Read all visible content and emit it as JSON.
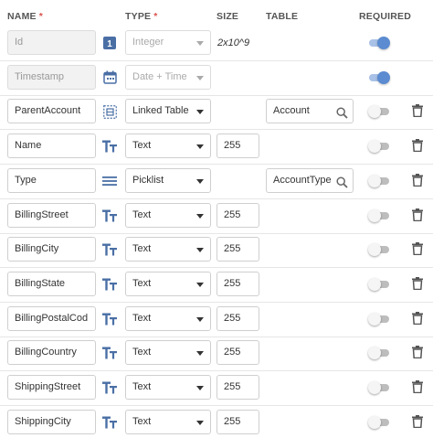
{
  "header": {
    "name": "NAME",
    "type": "TYPE",
    "size": "SIZE",
    "table": "TABLE",
    "required": "REQUIRED",
    "required_marker": "*"
  },
  "rows": [
    {
      "name": "Id",
      "type": "Integer",
      "size": "2x10^9",
      "table": "",
      "required": true,
      "locked": true,
      "icon": "number-badge-icon",
      "icon_text": "1"
    },
    {
      "name": "Timestamp",
      "type": "Date + Time",
      "size": "",
      "table": "",
      "required": true,
      "locked": true,
      "icon": "calendar-icon"
    },
    {
      "name": "ParentAccount",
      "type": "Linked Table",
      "size": "",
      "table": "Account",
      "required": false,
      "locked": false,
      "icon": "linked-table-icon"
    },
    {
      "name": "Name",
      "type": "Text",
      "size": "255",
      "table": "",
      "required": false,
      "locked": false,
      "icon": "text-type-icon"
    },
    {
      "name": "Type",
      "type": "Picklist",
      "size": "",
      "table": "AccountType",
      "required": false,
      "locked": false,
      "icon": "picklist-icon"
    },
    {
      "name": "BillingStreet",
      "type": "Text",
      "size": "255",
      "table": "",
      "required": false,
      "locked": false,
      "icon": "text-type-icon"
    },
    {
      "name": "BillingCity",
      "type": "Text",
      "size": "255",
      "table": "",
      "required": false,
      "locked": false,
      "icon": "text-type-icon"
    },
    {
      "name": "BillingState",
      "type": "Text",
      "size": "255",
      "table": "",
      "required": false,
      "locked": false,
      "icon": "text-type-icon"
    },
    {
      "name": "BillingPostalCod",
      "type": "Text",
      "size": "255",
      "table": "",
      "required": false,
      "locked": false,
      "icon": "text-type-icon"
    },
    {
      "name": "BillingCountry",
      "type": "Text",
      "size": "255",
      "table": "",
      "required": false,
      "locked": false,
      "icon": "text-type-icon"
    },
    {
      "name": "ShippingStreet",
      "type": "Text",
      "size": "255",
      "table": "",
      "required": false,
      "locked": false,
      "icon": "text-type-icon"
    },
    {
      "name": "ShippingCity",
      "type": "Text",
      "size": "255",
      "table": "",
      "required": false,
      "locked": false,
      "icon": "text-type-icon"
    }
  ],
  "colors": {
    "accent": "#4a6fa5",
    "toggle_on": "#5b8bd0",
    "toggle_off": "#bdbdbd",
    "required_star": "#d9534f"
  }
}
